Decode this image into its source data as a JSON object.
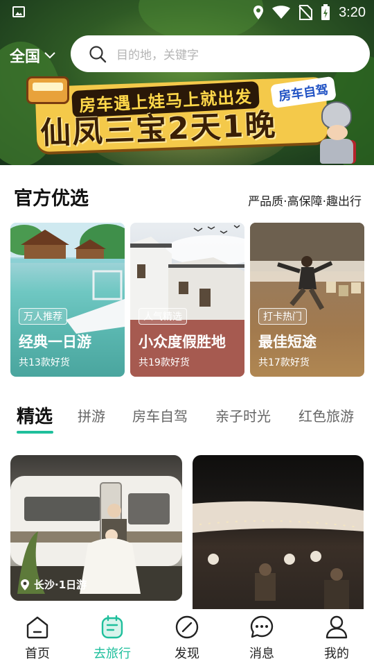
{
  "status_bar": {
    "time": "3:20"
  },
  "header": {
    "region": "全国",
    "search_placeholder": "目的地，关键字"
  },
  "banner": {
    "subtitle": "房车遇上娃马上就出发",
    "tag": "房车自驾",
    "title": "仙凤三宝2天1晚"
  },
  "official": {
    "title": "官方优选",
    "slogan": "严品质·高保障·趣出行",
    "cards": [
      {
        "tag": "万人推荐",
        "title": "经典一日游",
        "count": "共13款好货"
      },
      {
        "tag": "人气精选",
        "title": "小众度假胜地",
        "count": "共19款好货"
      },
      {
        "tag": "打卡热门",
        "title": "最佳短途",
        "count": "共17款好货"
      }
    ]
  },
  "tabs": [
    "精选",
    "拼游",
    "房车自驾",
    "亲子时光",
    "红色旅游"
  ],
  "feed": [
    {
      "location": "长沙·1日游"
    },
    {
      "location": ""
    }
  ],
  "bottom_nav": [
    {
      "label": "首页"
    },
    {
      "label": "去旅行"
    },
    {
      "label": "发现"
    },
    {
      "label": "消息"
    },
    {
      "label": "我的"
    }
  ],
  "colors": {
    "accent": "#1fbf9c"
  }
}
